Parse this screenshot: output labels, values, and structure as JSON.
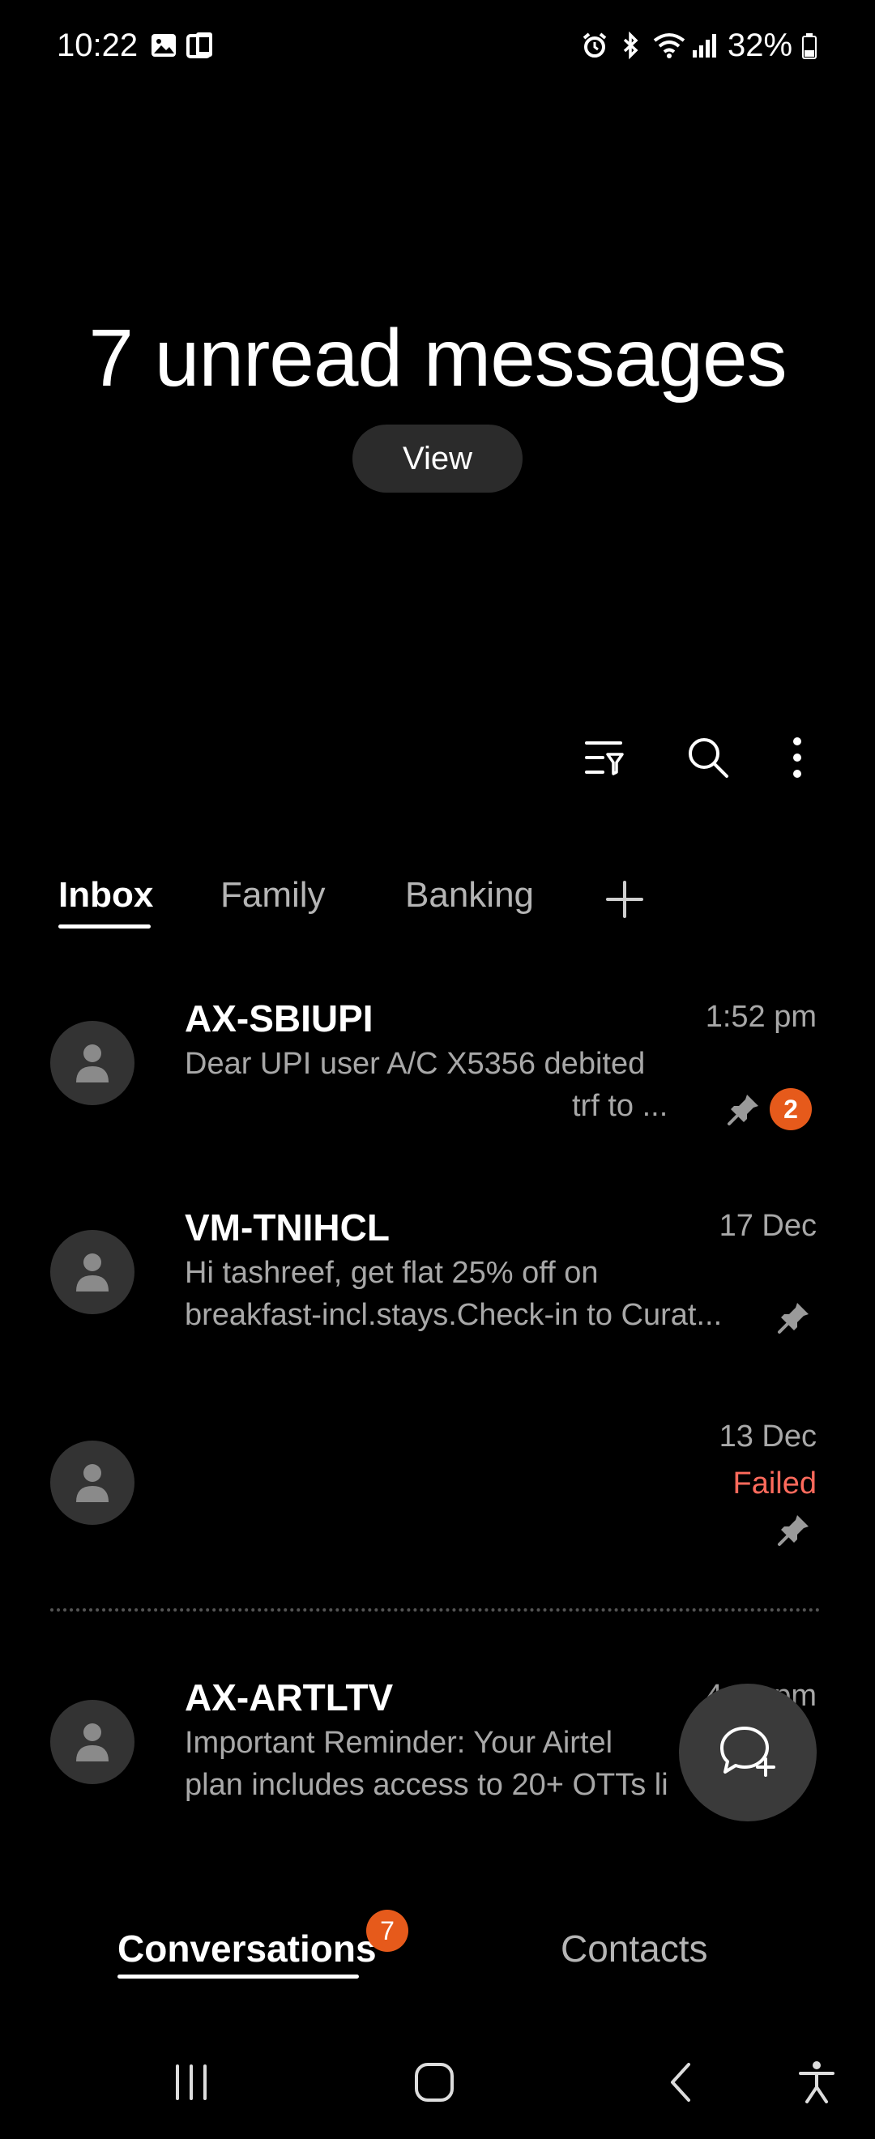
{
  "status_bar": {
    "time": "10:22",
    "battery": "32%"
  },
  "header": {
    "headline": "7 unread messages",
    "view_label": "View"
  },
  "toolbar": {
    "icons": [
      "filter-icon",
      "search-icon",
      "more-vert-icon"
    ]
  },
  "tabs": [
    {
      "label": "Inbox",
      "active": true
    },
    {
      "label": "Family",
      "active": false
    },
    {
      "label": "Banking",
      "active": false
    }
  ],
  "conversations": [
    {
      "name": "AX-SBIUPI",
      "time": "1:52 pm",
      "line1": "Dear UPI user A/C X5356 debited",
      "line2": "trf to ...",
      "pinned": true,
      "unread": "2"
    },
    {
      "name": "VM-TNIHCL",
      "time": "17 Dec",
      "line1": "Hi tashreef, get flat 25% off on",
      "line2": "breakfast-incl.stays.Check-in to Curat...",
      "pinned": true
    },
    {
      "name": "",
      "time": "13 Dec",
      "status": "Failed",
      "pinned": true
    },
    {
      "name": "AX-ARTLTV",
      "time": "4:__ pm",
      "line1": "Important Reminder: Your Airtel",
      "line2": "plan includes access to 20+ OTTs li"
    }
  ],
  "bottom_nav": {
    "conversations_label": "Conversations",
    "conversations_badge": "7",
    "contacts_label": "Contacts"
  },
  "colors": {
    "accent_badge": "#e65a1b",
    "failed": "#ff6a5c",
    "background": "#000000"
  }
}
